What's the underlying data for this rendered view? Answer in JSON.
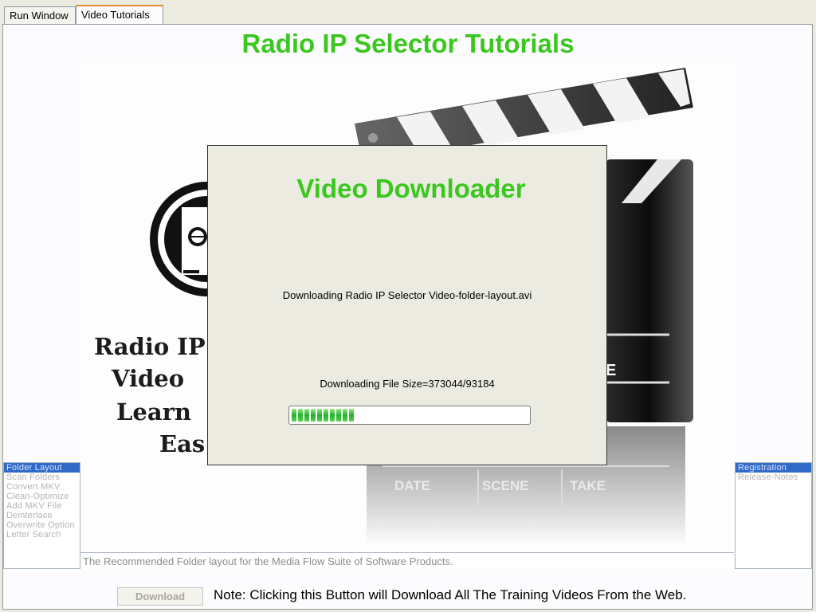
{
  "tabs": [
    {
      "label": "Run Window"
    },
    {
      "label": "Video Tutorials"
    }
  ],
  "main": {
    "title": "Radio IP Selector Tutorials",
    "caption": "The Recommended Folder layout for the Media Flow Suite of Software Products."
  },
  "video": {
    "overlay_text": [
      "Radio IP",
      "Video",
      "Learn",
      "Eas"
    ],
    "slate_labels": [
      "DATE",
      "SCENE",
      "TAKE"
    ]
  },
  "left_list": {
    "items": [
      "Folder Layout",
      "Scan Folders",
      "Convert MKV",
      "Clean-Optimize",
      "Add MKV File",
      "Deinterlace",
      "Overwrite Option",
      "Letter Search"
    ],
    "selected": "Folder Layout"
  },
  "right_list": {
    "items": [
      "Registration",
      "Release-Notes"
    ],
    "selected": "Registration"
  },
  "bottom": {
    "download_label": "Download",
    "note": "Note: Clicking this Button will Download All The Training Videos From the Web."
  },
  "dialog": {
    "title": "Video Downloader",
    "status": "Downloading Radio IP Selector Video-folder-layout.avi",
    "size_text": "Downloading File Size=373044/93184",
    "progress_fraction": 0.27
  },
  "colors": {
    "accent_green": "#3bc71f",
    "selection_blue": "#3169c6",
    "tab_highlight": "#e68b2c"
  }
}
